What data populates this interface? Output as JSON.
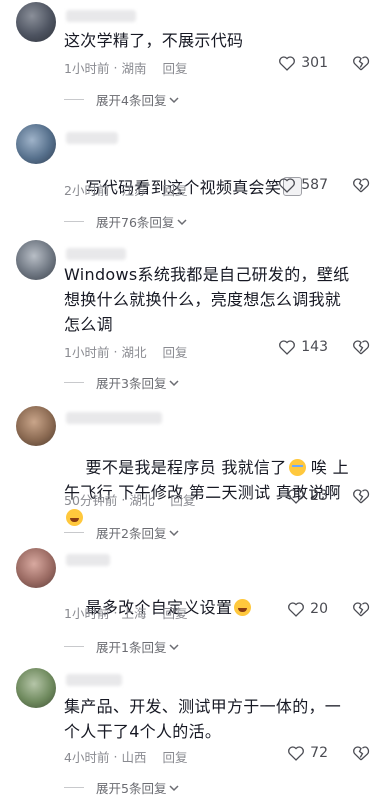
{
  "comments": [
    {
      "text": "这次学精了，不展示代码",
      "time": "1小时前",
      "location": "湖南",
      "reply": "回复",
      "likes": "301",
      "expand": "展开4条回复"
    },
    {
      "text": "写代码看到这个视频真会笑",
      "emoji": "cat-face",
      "time": "2小时前",
      "location": "江苏",
      "reply": "回复",
      "likes": "587",
      "expand": "展开76条回复"
    },
    {
      "text": "Windows系统我都是自己研发的，壁纸想换什么就换什么，亮度想怎么调我就怎么调",
      "time": "1小时前",
      "location": "湖北",
      "reply": "回复",
      "likes": "143",
      "expand": "展开3条回复"
    },
    {
      "text_part1": "要不是我是程序员 我就信了",
      "emoji1": "crying-face",
      "text_part2": " 唉 上午飞行 下午修改 第二天测试 真敢说啊",
      "emoji2": "laughing-face",
      "time": "50分钟前",
      "location": "湖北",
      "reply": "回复",
      "likes": "23",
      "expand": "展开2条回复"
    },
    {
      "text": "最多改个自定义设置",
      "emoji": "laughing-face",
      "time": "1小时前",
      "location": "上海",
      "reply": "回复",
      "likes": "20",
      "expand": "展开1条回复"
    },
    {
      "text": "集产品、开发、测试甲方于一体的，一个人干了4个人的活。",
      "time": "4小时前",
      "location": "山西",
      "reply": "回复",
      "likes": "72",
      "expand": "展开5条回复"
    }
  ],
  "separator": "·"
}
